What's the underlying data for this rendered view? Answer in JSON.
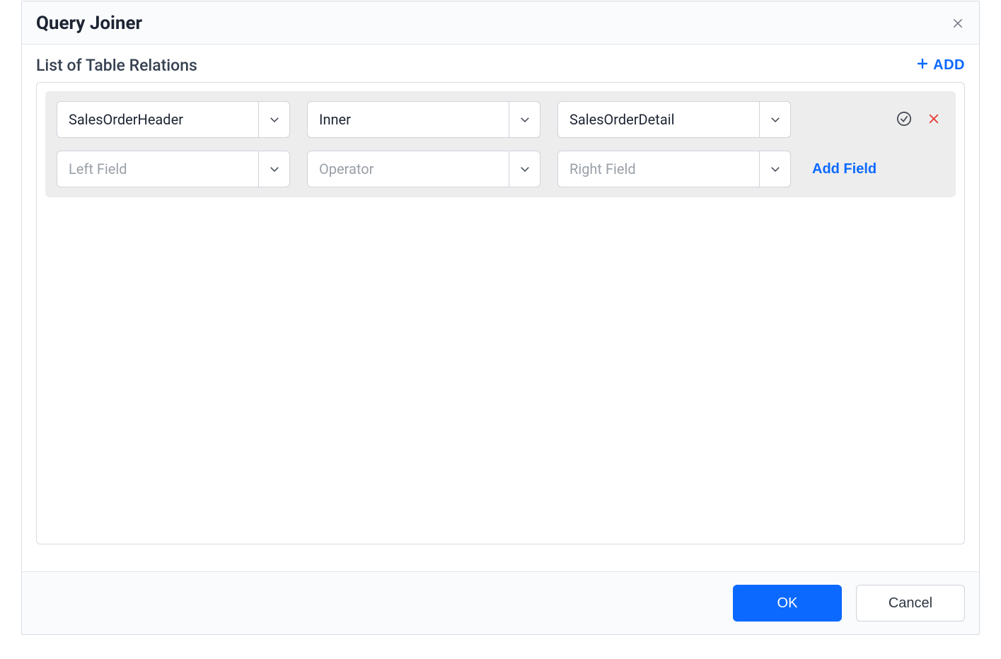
{
  "dialog": {
    "title": "Query Joiner",
    "section_title": "List of Table Relations",
    "add_label": "ADD"
  },
  "relation": {
    "left_table": "SalesOrderHeader",
    "join_type": "Inner",
    "right_table": "SalesOrderDetail",
    "left_field_placeholder": "Left Field",
    "operator_placeholder": "Operator",
    "right_field_placeholder": "Right Field",
    "add_field_label": "Add Field"
  },
  "footer": {
    "ok_label": "OK",
    "cancel_label": "Cancel"
  },
  "icons": {
    "close": "close-icon",
    "plus": "plus-icon",
    "chevron_down": "chevron-down-icon",
    "check_circle": "check-circle-icon",
    "remove_x": "remove-icon"
  },
  "colors": {
    "accent": "#0b69ff",
    "danger": "#e53935",
    "border": "#d7dbe2",
    "panel": "#ededed",
    "text": "#1d2433",
    "placeholder": "#9aa0a8"
  }
}
